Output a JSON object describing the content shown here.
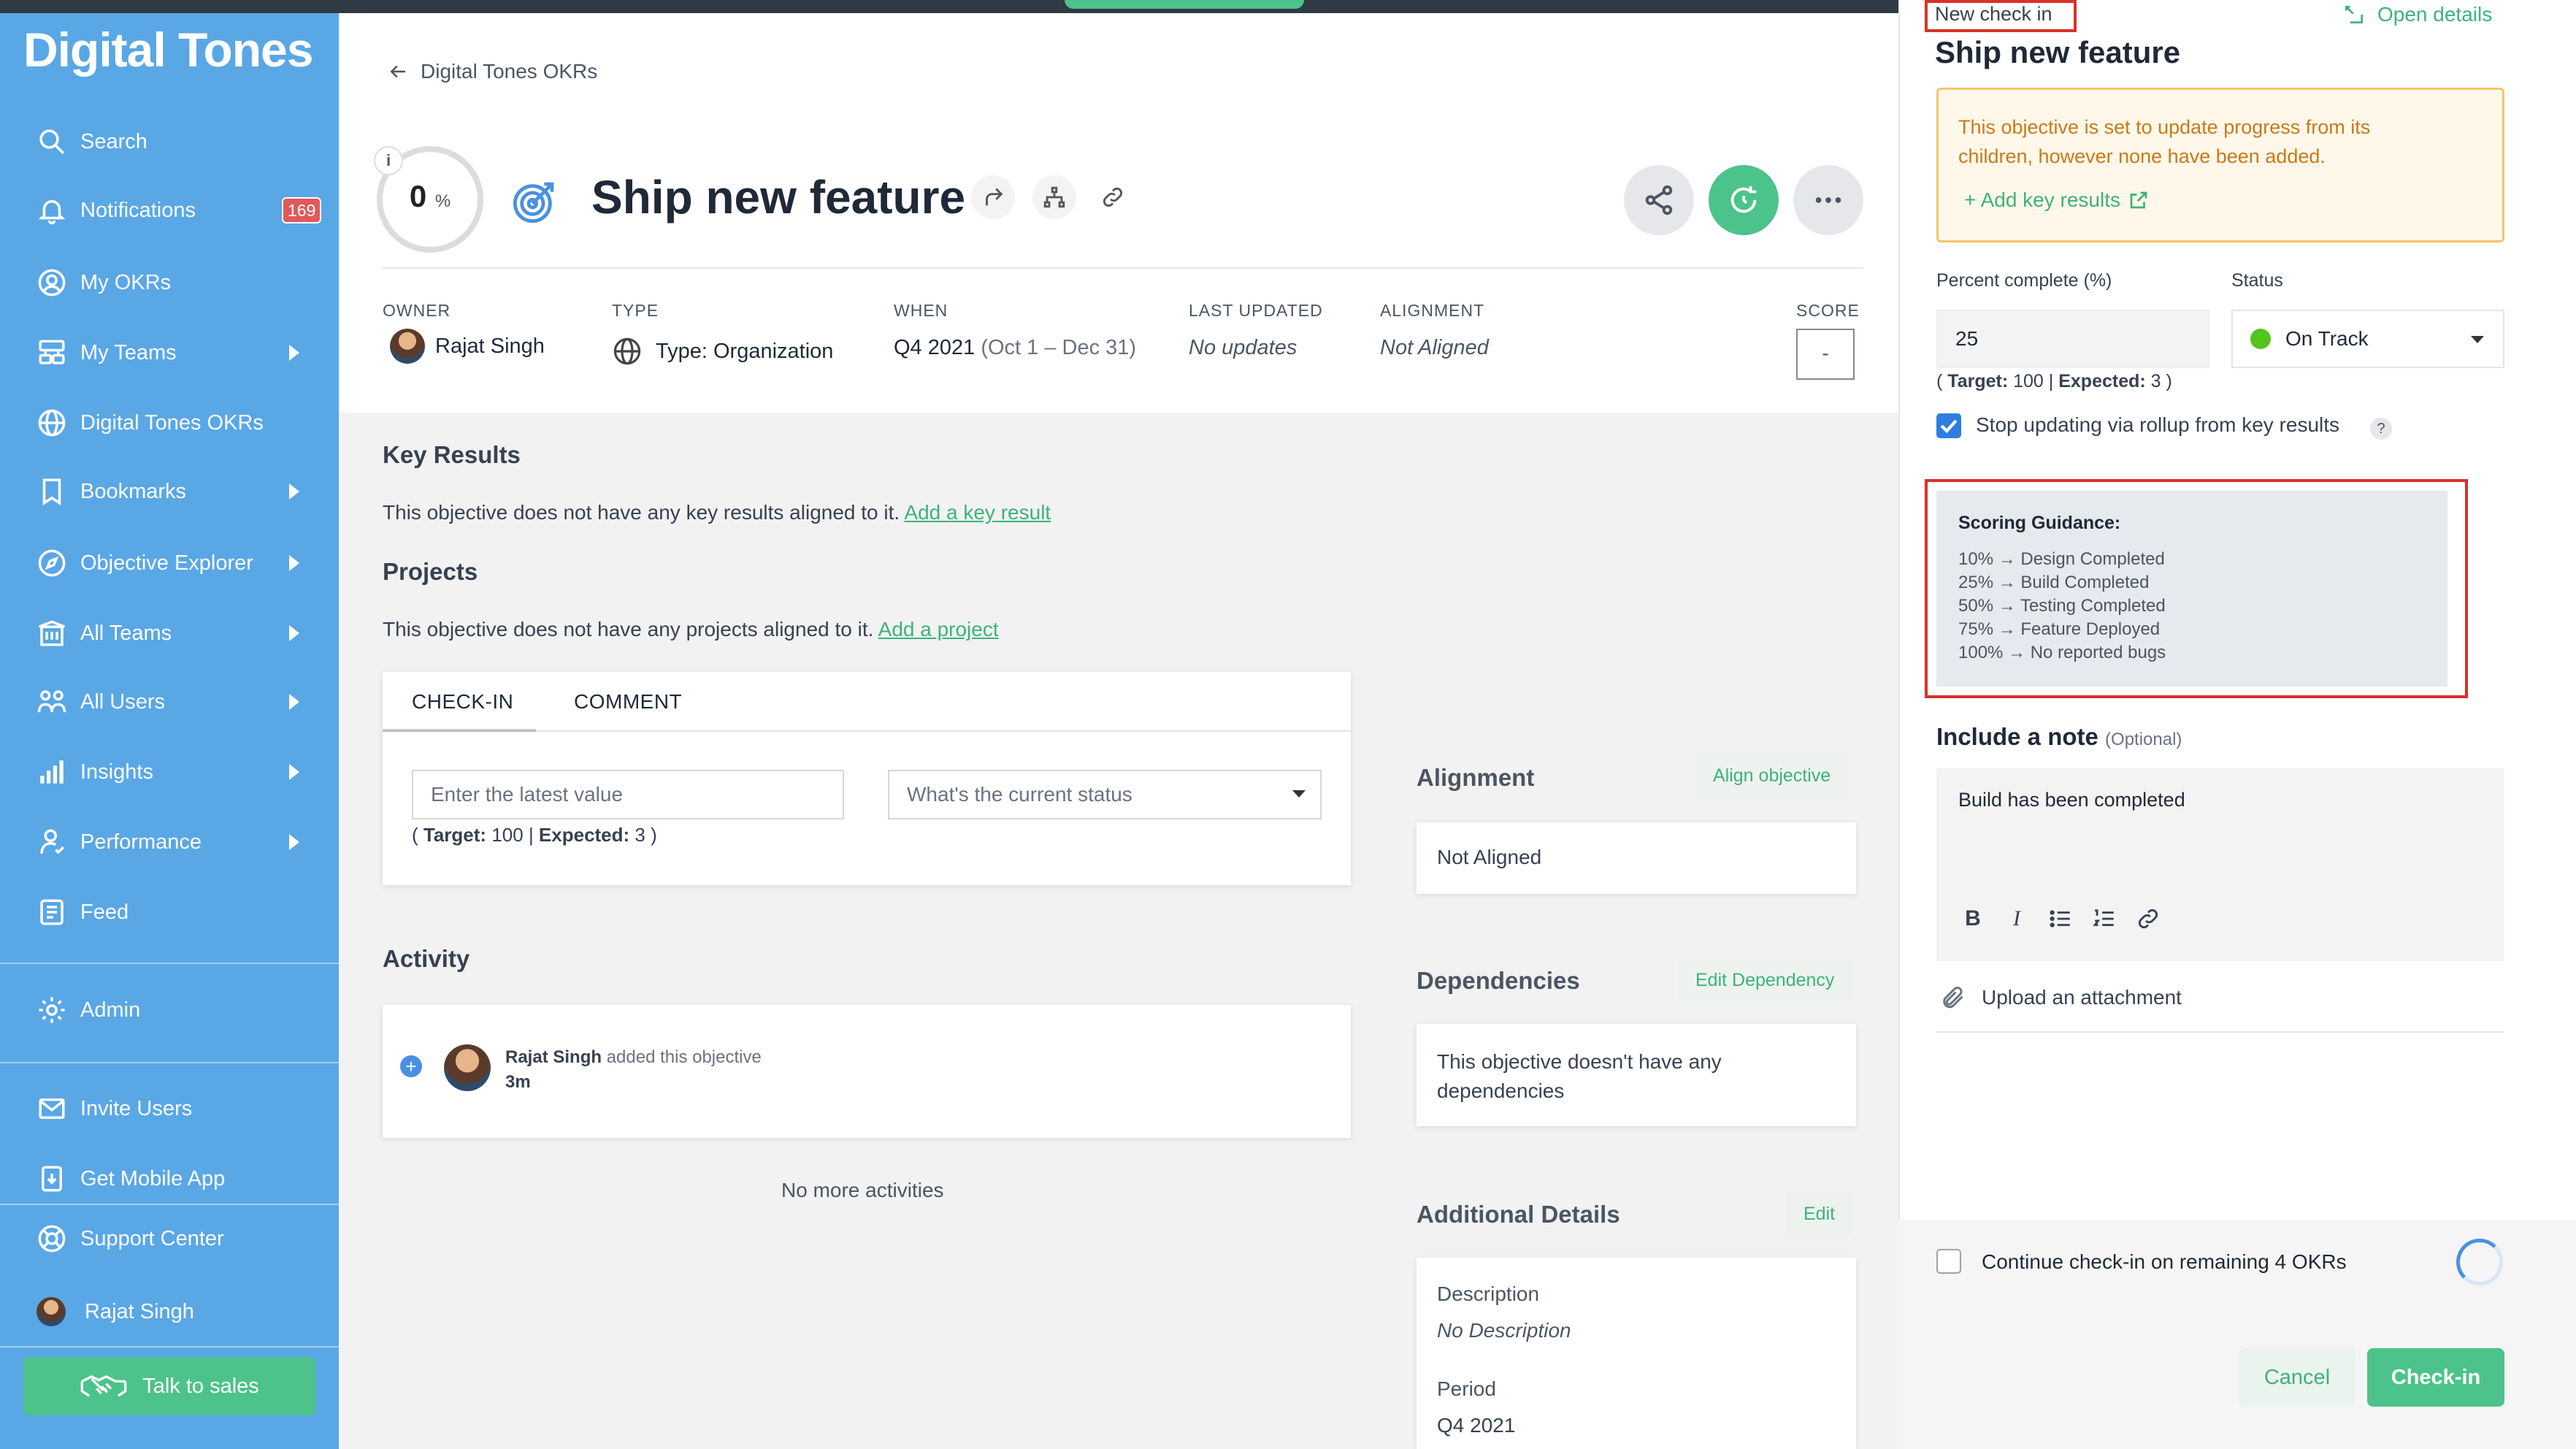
{
  "sidebar": {
    "brand": "Digital Tones",
    "items": [
      {
        "label": "Search"
      },
      {
        "label": "Notifications",
        "badge": "169"
      },
      {
        "label": "My OKRs"
      },
      {
        "label": "My Teams"
      },
      {
        "label": "Digital Tones OKRs"
      },
      {
        "label": "Bookmarks"
      },
      {
        "label": "Objective Explorer"
      },
      {
        "label": "All Teams"
      },
      {
        "label": "All Users"
      },
      {
        "label": "Insights"
      },
      {
        "label": "Performance"
      },
      {
        "label": "Feed"
      }
    ],
    "admin": "Admin",
    "invite": "Invite Users",
    "mobile": "Get Mobile App",
    "support": "Support Center",
    "user": "Rajat Singh",
    "talk": "Talk to sales"
  },
  "header": {
    "breadcrumb": "Digital Tones OKRs",
    "progress_value": "0",
    "progress_unit": "%",
    "info": "i",
    "title": "Ship new feature"
  },
  "meta": {
    "owner_label": "OWNER",
    "owner": "Rajat Singh",
    "type_label": "TYPE",
    "type": "Type: Organization",
    "when_label": "WHEN",
    "when_quarter": "Q4 2021",
    "when_range": "(Oct 1 – Dec 31)",
    "updated_label": "LAST UPDATED",
    "updated": "No updates",
    "alignment_label": "ALIGNMENT",
    "alignment": "Not Aligned",
    "score_label": "SCORE",
    "score": "-"
  },
  "key_results": {
    "title": "Key Results",
    "text": "This objective does not have any key results aligned to it.",
    "link": "Add a key result"
  },
  "projects": {
    "title": "Projects",
    "text": "This objective does not have any projects aligned to it.",
    "link": "Add a project"
  },
  "checkin_card": {
    "tab_checkin": "CHECK-IN",
    "tab_comment": "COMMENT",
    "value_placeholder": "Enter the latest value",
    "status_placeholder": "What's the current status",
    "target_label": "Target:",
    "target_value": "100",
    "expected_label": "Expected:",
    "expected_value": "3"
  },
  "activity": {
    "title": "Activity",
    "user": "Rajat Singh",
    "action": "added this objective",
    "time": "3m",
    "end": "No more activities"
  },
  "alignment_card": {
    "title": "Alignment",
    "button": "Align objective",
    "text": "Not Aligned"
  },
  "dependencies_card": {
    "title": "Dependencies",
    "button": "Edit Dependency",
    "text_line1": "This objective doesn't have any",
    "text_line2": "dependencies"
  },
  "details_card": {
    "title": "Additional Details",
    "button": "Edit",
    "description_label": "Description",
    "description": "No Description",
    "period_label": "Period",
    "period": "Q4 2021"
  },
  "panel": {
    "new_checkin": "New check in",
    "open_details": "Open details",
    "title": "Ship new feature",
    "warning_line1": "This objective is set to update progress from its",
    "warning_line2": "children, however none have been added.",
    "add_key_results": "+ Add key results",
    "percent_label": "Percent complete (%)",
    "percent_value": "25",
    "status_label": "Status",
    "status_value": "On Track",
    "status_color": "#52c41a",
    "target_label": "Target:",
    "target_value": "100",
    "expected_label": "Expected:",
    "expected_value": "3",
    "rollup_label": "Stop updating via rollup from key results",
    "rollup_checked": true,
    "help": "?",
    "guidance_title": "Scoring Guidance:",
    "guidance": [
      "10% → Design Completed",
      "25% → Build Completed",
      "50% → Testing Completed",
      "75% → Feature Deployed",
      "100% → No reported bugs"
    ],
    "note_title": "Include a note",
    "note_optional": "(Optional)",
    "note_text": "Build has been completed",
    "upload": "Upload an attachment",
    "continue_label": "Continue check-in on remaining 4 OKRs",
    "cancel": "Cancel",
    "checkin": "Check-in"
  },
  "colors": {
    "sidebar": "#5aa7e6",
    "accent_green": "#4cc38a",
    "annotation_red": "#d9312b"
  }
}
